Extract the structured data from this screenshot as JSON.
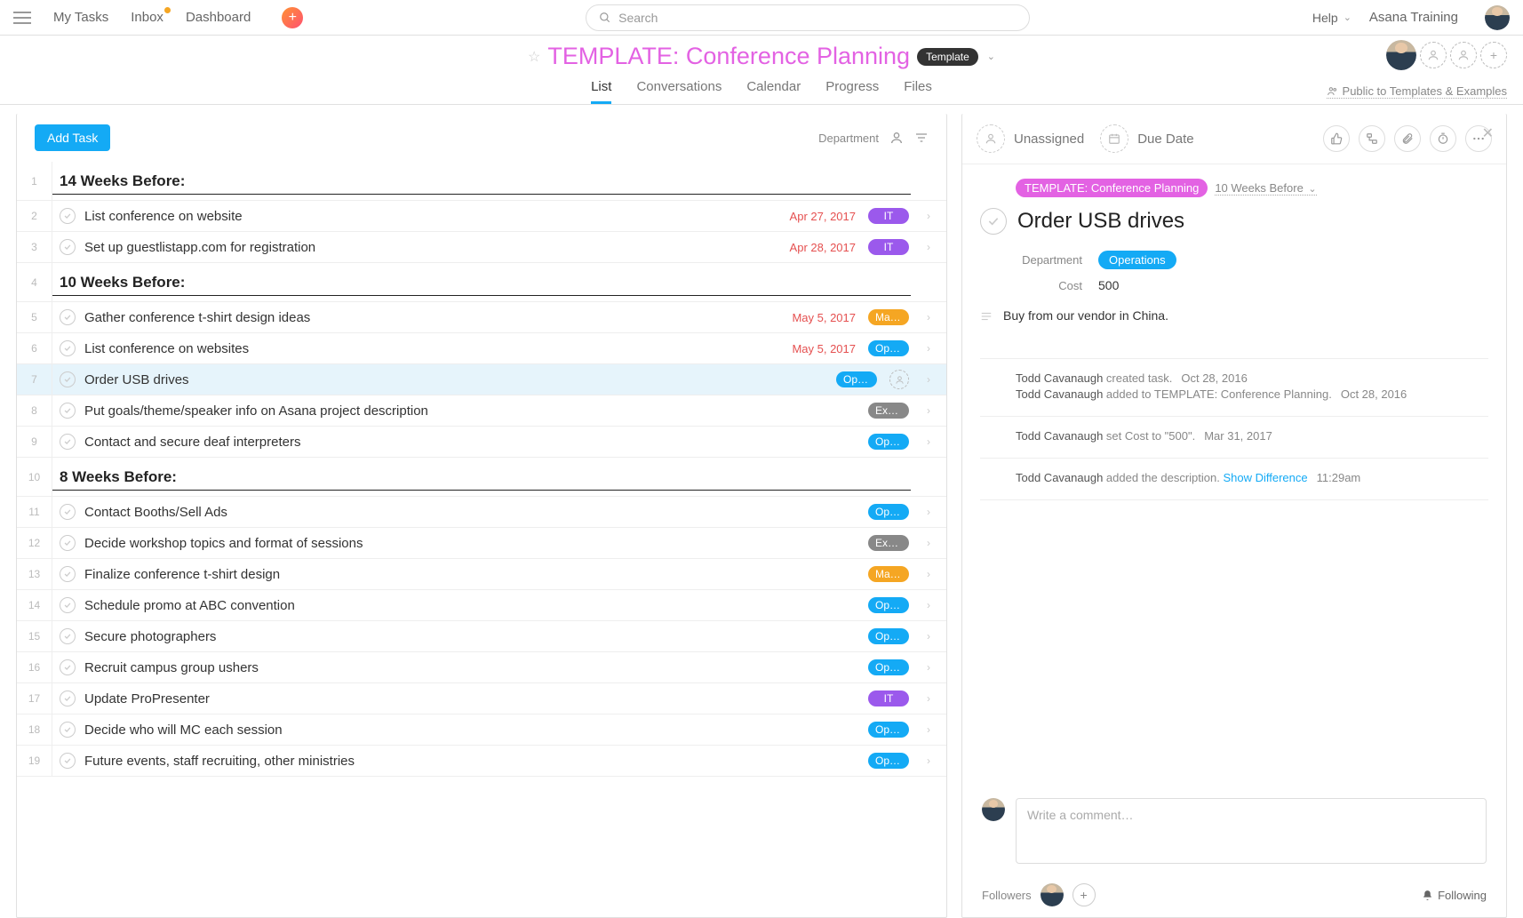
{
  "topnav": {
    "my_tasks": "My Tasks",
    "inbox": "Inbox",
    "dashboard": "Dashboard",
    "search_placeholder": "Search",
    "help": "Help",
    "workspace": "Asana Training"
  },
  "project": {
    "title": "TEMPLATE: Conference Planning",
    "badge": "Template",
    "privacy": "Public to Templates & Examples",
    "tabs": {
      "list": "List",
      "conversations": "Conversations",
      "calendar": "Calendar",
      "progress": "Progress",
      "files": "Files"
    }
  },
  "toolbar": {
    "add_task": "Add Task",
    "sort_label": "Department"
  },
  "rows": [
    {
      "num": "1",
      "type": "section",
      "name": "14 Weeks Before:"
    },
    {
      "num": "2",
      "type": "task",
      "name": "List conference on website",
      "date": "Apr 27, 2017",
      "tag": "IT",
      "tagClass": "tag-it"
    },
    {
      "num": "3",
      "type": "task",
      "name": "Set up guestlistapp.com for registration",
      "date": "Apr 28, 2017",
      "tag": "IT",
      "tagClass": "tag-it"
    },
    {
      "num": "4",
      "type": "section",
      "name": "10 Weeks Before:"
    },
    {
      "num": "5",
      "type": "task",
      "name": "Gather conference t-shirt design ideas",
      "date": "May 5, 2017",
      "tag": "Mark…",
      "tagClass": "tag-mark"
    },
    {
      "num": "6",
      "type": "task",
      "name": "List conference on websites",
      "date": "May 5, 2017",
      "tag": "Oper…",
      "tagClass": "tag-oper"
    },
    {
      "num": "7",
      "type": "task",
      "name": "Order USB drives",
      "tag": "Oper…",
      "tagClass": "tag-oper",
      "selected": true,
      "assignee_dashed": true
    },
    {
      "num": "8",
      "type": "task",
      "name": "Put goals/theme/speaker info on Asana project description",
      "tag": "Exec…",
      "tagClass": "tag-exec"
    },
    {
      "num": "9",
      "type": "task",
      "name": "Contact and secure deaf interpreters",
      "tag": "Oper…",
      "tagClass": "tag-oper"
    },
    {
      "num": "10",
      "type": "section",
      "name": "8 Weeks Before:"
    },
    {
      "num": "11",
      "type": "task",
      "name": "Contact Booths/Sell Ads",
      "tag": "Oper…",
      "tagClass": "tag-oper"
    },
    {
      "num": "12",
      "type": "task",
      "name": "Decide workshop topics and format of sessions",
      "tag": "Exec…",
      "tagClass": "tag-exec"
    },
    {
      "num": "13",
      "type": "task",
      "name": "Finalize conference t-shirt design",
      "tag": "Mark…",
      "tagClass": "tag-mark"
    },
    {
      "num": "14",
      "type": "task",
      "name": "Schedule promo at ABC convention",
      "tag": "Oper…",
      "tagClass": "tag-oper"
    },
    {
      "num": "15",
      "type": "task",
      "name": "Secure photographers",
      "tag": "Oper…",
      "tagClass": "tag-oper"
    },
    {
      "num": "16",
      "type": "task",
      "name": "Recruit campus group ushers",
      "tag": "Oper…",
      "tagClass": "tag-oper"
    },
    {
      "num": "17",
      "type": "task",
      "name": "Update ProPresenter",
      "tag": "IT",
      "tagClass": "tag-it"
    },
    {
      "num": "18",
      "type": "task",
      "name": "Decide who will MC each session",
      "tag": "Oper…",
      "tagClass": "tag-oper"
    },
    {
      "num": "19",
      "type": "task",
      "name": "Future events, staff recruiting, other ministries",
      "tag": "Oper…",
      "tagClass": "tag-oper"
    }
  ],
  "detail": {
    "unassigned": "Unassigned",
    "due_date": "Due Date",
    "project_pill": "TEMPLATE: Conference Planning",
    "section": "10 Weeks Before",
    "title": "Order USB drives",
    "fields": {
      "department_label": "Department",
      "department_value": "Operations",
      "cost_label": "Cost",
      "cost_value": "500"
    },
    "description": "Buy from our vendor in China.",
    "history": [
      {
        "lines": [
          {
            "who": "Todd Cavanaugh",
            "action": " created task.",
            "date": "Oct 28, 2016"
          },
          {
            "who": "Todd Cavanaugh",
            "action": " added to TEMPLATE: Conference Planning.",
            "date": "Oct 28, 2016"
          }
        ]
      },
      {
        "lines": [
          {
            "who": "Todd Cavanaugh",
            "action": " set Cost to \"500\".",
            "date": "Mar 31, 2017"
          }
        ]
      },
      {
        "lines": [
          {
            "who": "Todd Cavanaugh",
            "action": " added the description. ",
            "link": "Show Difference",
            "date": "11:29am"
          }
        ]
      }
    ],
    "comment_placeholder": "Write a comment…",
    "followers_label": "Followers",
    "following_label": "Following"
  }
}
